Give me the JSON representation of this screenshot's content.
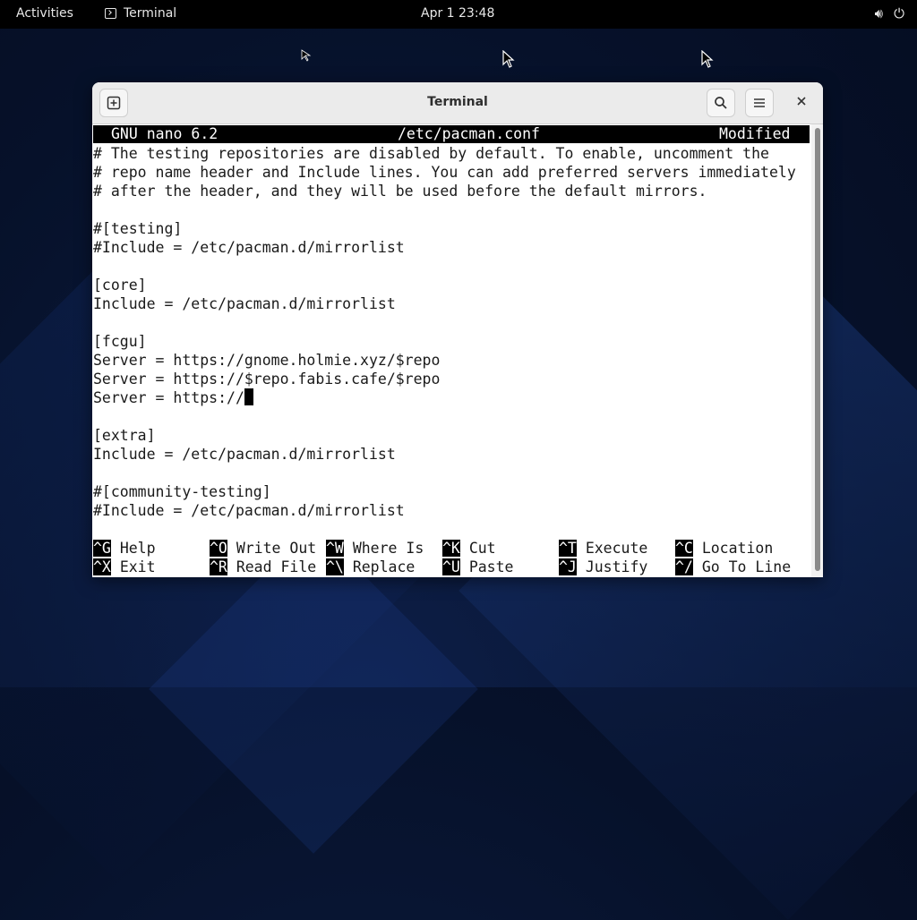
{
  "topbar": {
    "activities": "Activities",
    "app_name": "Terminal",
    "clock": "Apr 1  23:48",
    "icons": [
      "speaker-icon",
      "power-icon"
    ]
  },
  "window": {
    "title": "Terminal",
    "buttons": [
      "new-tab-icon",
      "search-icon",
      "menu-icon",
      "close-icon"
    ]
  },
  "nano": {
    "version": "GNU nano 6.2",
    "filename": "/etc/pacman.conf",
    "status": "Modified",
    "lines": [
      "# The testing repositories are disabled by default. To enable, uncomment the",
      "# repo name header and Include lines. You can add preferred servers immediately",
      "# after the header, and they will be used before the default mirrors.",
      "",
      "#[testing]",
      "#Include = /etc/pacman.d/mirrorlist",
      "",
      "[core]",
      "Include = /etc/pacman.d/mirrorlist",
      "",
      "[fcgu]",
      "Server = https://gnome.holmie.xyz/$repo",
      "Server = https://$repo.fabis.cafe/$repo",
      "Server = https://",
      "",
      "[extra]",
      "Include = /etc/pacman.d/mirrorlist",
      "",
      "#[community-testing]",
      "#Include = /etc/pacman.d/mirrorlist",
      ""
    ],
    "shortcuts": [
      {
        "key": "^G",
        "label": "Help"
      },
      {
        "key": "^O",
        "label": "Write Out"
      },
      {
        "key": "^W",
        "label": "Where Is"
      },
      {
        "key": "^K",
        "label": "Cut"
      },
      {
        "key": "^T",
        "label": "Execute"
      },
      {
        "key": "^C",
        "label": "Location"
      },
      {
        "key": "^X",
        "label": "Exit"
      },
      {
        "key": "^R",
        "label": "Read File"
      },
      {
        "key": "^\\",
        "label": "Replace"
      },
      {
        "key": "^U",
        "label": "Paste"
      },
      {
        "key": "^J",
        "label": "Justify"
      },
      {
        "key": "^/",
        "label": "Go To Line"
      }
    ]
  }
}
